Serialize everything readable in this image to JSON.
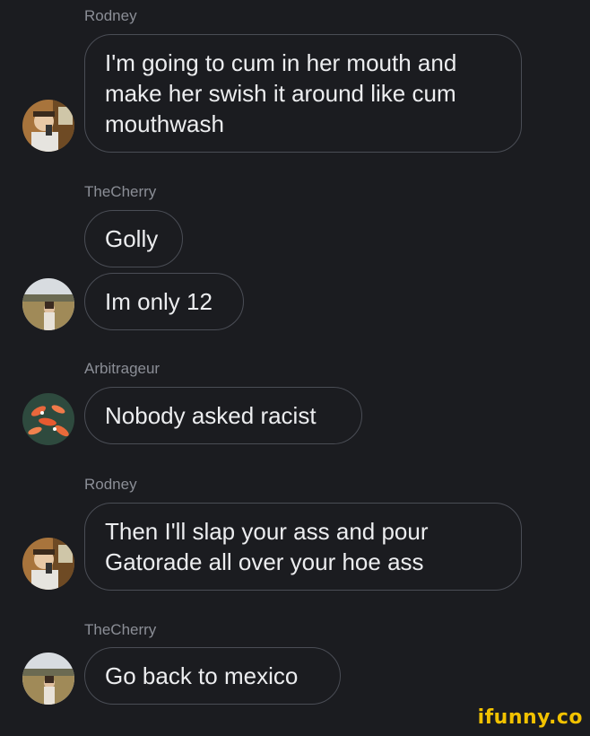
{
  "messages": [
    {
      "author": "Rodney",
      "bubbles": [
        "I'm going to cum in her mouth and make her swish it around like cum mouthwash"
      ]
    },
    {
      "author": "TheCherry",
      "bubbles": [
        "Golly",
        "Im only 12"
      ]
    },
    {
      "author": "Arbitrageur",
      "bubbles": [
        "Nobody asked racist"
      ]
    },
    {
      "author": "Rodney",
      "bubbles": [
        "Then I'll slap your ass and pour Gatorade all over your hoe ass"
      ]
    },
    {
      "author": "TheCherry",
      "bubbles": [
        "Go back to mexico"
      ]
    }
  ],
  "watermark": "ifunny.co",
  "colors": {
    "background": "#1b1c20",
    "bubble_border": "#4a4d55",
    "author_text": "#8b8e96",
    "watermark": "#f2c200"
  }
}
